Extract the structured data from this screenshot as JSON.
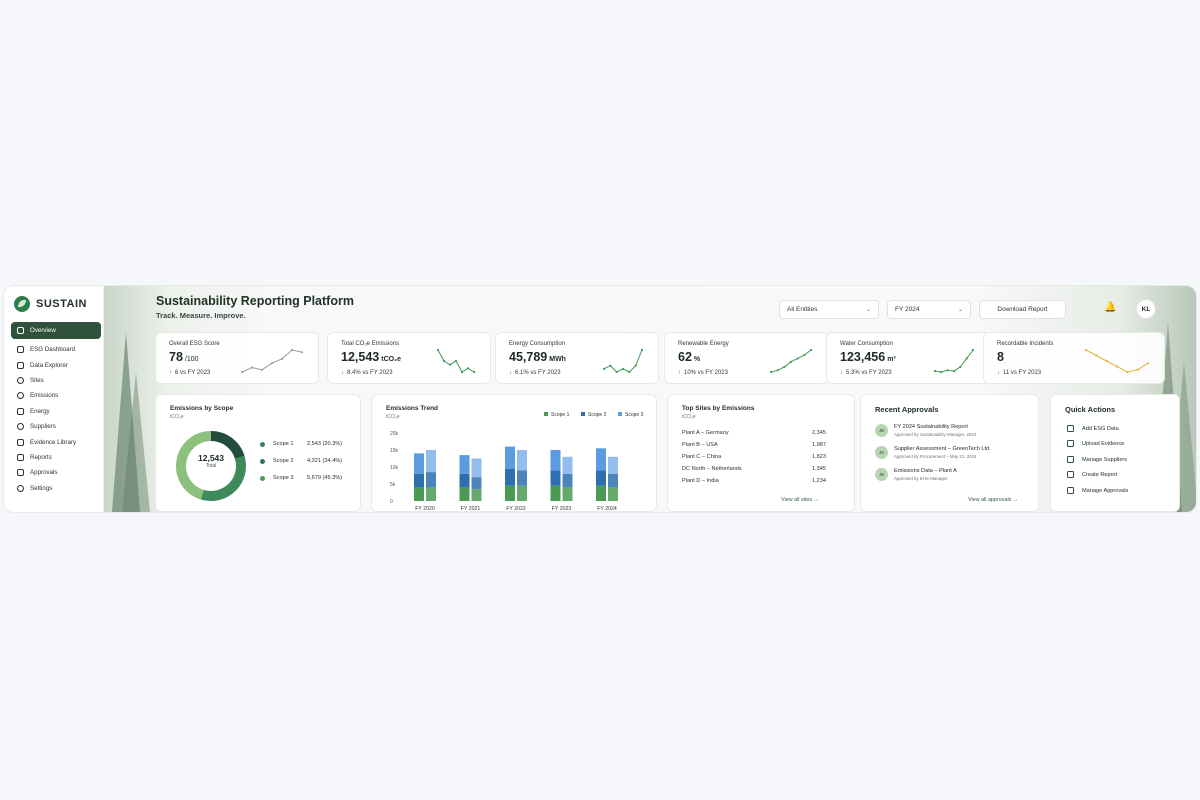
{
  "brand": {
    "name": "SUSTAIN"
  },
  "sidebar": {
    "items": [
      {
        "label": "Overview",
        "icon": "home-icon",
        "active": true
      },
      {
        "label": "ESG Dashboard",
        "icon": "dashboard-icon"
      },
      {
        "label": "Data Explorer",
        "icon": "table-icon"
      },
      {
        "label": "Sites",
        "icon": "pin-icon"
      },
      {
        "label": "Emissions",
        "icon": "cloud-icon"
      },
      {
        "label": "Energy",
        "icon": "bolt-icon"
      },
      {
        "label": "Suppliers",
        "icon": "users-icon"
      },
      {
        "label": "Evidence Library",
        "icon": "folder-icon"
      },
      {
        "label": "Reports",
        "icon": "report-icon"
      },
      {
        "label": "Approvals",
        "icon": "check-icon"
      },
      {
        "label": "Settings",
        "icon": "gear-icon"
      }
    ]
  },
  "header": {
    "title": "Sustainability Reporting Platform",
    "subtitle": "Track. Measure. Improve.",
    "entity_select": "All Entities",
    "year_select": "FY 2024",
    "download_label": "Download Report",
    "avatar_initials": "KL"
  },
  "kpis": [
    {
      "label": "Overall ESG Score",
      "value": "78",
      "unit": "/100",
      "delta": "6",
      "delta_suffix": "vs FY 2023",
      "color": "#9a9a9a",
      "spark": [
        3,
        4,
        3.5,
        5,
        6,
        8,
        7.5
      ]
    },
    {
      "label": "Total CO₂e Emissions",
      "value": "12,543",
      "unit": "tCO₂e",
      "delta": "8.4%",
      "delta_suffix": "vs FY 2023",
      "color": "#3f9a55",
      "spark": [
        9,
        6,
        5,
        6,
        3,
        4,
        3
      ]
    },
    {
      "label": "Energy Consumption",
      "value": "45,789",
      "unit": "MWh",
      "delta": "6.1%",
      "delta_suffix": "vs FY 2023",
      "color": "#3f9a55",
      "spark": [
        5,
        5.5,
        4.5,
        5,
        4.5,
        5.5,
        8
      ]
    },
    {
      "label": "Renewable Energy",
      "value": "62",
      "unit": "%",
      "delta": "10%",
      "delta_suffix": "vs FY 2023",
      "color": "#3f9a55",
      "spark": [
        2,
        2.5,
        3.5,
        5,
        6,
        7,
        8.5
      ]
    },
    {
      "label": "Water Consumption",
      "value": "123,456",
      "unit": "m³",
      "delta": "5.3%",
      "delta_suffix": "vs FY 2023",
      "color": "#3f9a55",
      "spark": [
        3,
        2.8,
        3.2,
        3,
        4,
        6,
        8
      ]
    },
    {
      "label": "Recordable Incidents",
      "value": "8",
      "unit": "",
      "delta": "11",
      "delta_suffix": "vs FY 2023",
      "color": "#e3b33c",
      "spark": [
        6,
        5.5,
        5,
        4.5,
        4,
        4.2,
        4.8
      ]
    }
  ],
  "emissions_by_scope": {
    "title": "Emissions by Scope",
    "unit": "tCO₂e",
    "total": "12,543",
    "total_label": "Total",
    "scopes": [
      {
        "name": "Scope 1",
        "value": "2,543 (20.3%)",
        "color": "#3e7d6b"
      },
      {
        "name": "Scope 2",
        "value": "4,321 (34.4%)",
        "color": "#2f6f6a"
      },
      {
        "name": "Scope 3",
        "value": "5,679 (45.3%)",
        "color": "#4a9a52"
      }
    ]
  },
  "chart_data": {
    "type": "bar",
    "title": "Emissions Trend",
    "ylabel": "tCO₂e",
    "categories": [
      "FY 2020",
      "FY 2021",
      "FY 2022",
      "FY 2023",
      "FY 2024"
    ],
    "yticks": [
      "20k",
      "15k",
      "10k",
      "5k",
      "0"
    ],
    "ylim": [
      0,
      20000
    ],
    "series": [
      {
        "name": "Scope 1",
        "color": "#4a9a52"
      },
      {
        "name": "Scope 2",
        "color": "#2e6fb0"
      },
      {
        "name": "Scope 3",
        "color": "#5b9be0"
      }
    ],
    "bars": [
      [
        [
          4000,
          4000,
          6000
        ],
        [
          4000,
          4500,
          6500
        ]
      ],
      [
        [
          4000,
          4000,
          5500
        ],
        [
          3500,
          3500,
          5500
        ]
      ],
      [
        [
          4500,
          5000,
          6500
        ],
        [
          4500,
          4500,
          6000
        ]
      ],
      [
        [
          4500,
          4500,
          6000
        ],
        [
          4000,
          4000,
          5000
        ]
      ],
      [
        [
          4500,
          4500,
          6500
        ],
        [
          4000,
          4000,
          5000
        ]
      ]
    ],
    "legend": "top-right"
  },
  "top_sites": {
    "title": "Top Sites by Emissions",
    "unit": "tCO₂e",
    "rows": [
      {
        "name": "Plant A – Germany",
        "value": "2,345"
      },
      {
        "name": "Plant B – USA",
        "value": "1,987"
      },
      {
        "name": "Plant C – China",
        "value": "1,823"
      },
      {
        "name": "DC North – Netherlands",
        "value": "1,345"
      },
      {
        "name": "Plant D – India",
        "value": "1,234"
      }
    ],
    "link": "View all sites →"
  },
  "approvals": {
    "title": "Recent Approvals",
    "items": [
      {
        "initials": "JB",
        "title": "FY 2024 Sustainability Report",
        "sub": "Approved by Sustainability Manager, 2024"
      },
      {
        "initials": "JS",
        "title": "Supplier Assessment – GreenTech Ltd.",
        "sub": "Approved by Procurement – May 21, 2024"
      },
      {
        "initials": "JB",
        "title": "Emissions Data – Plant A",
        "sub": "Approved by EHS Manager"
      }
    ],
    "link": "View all approvals →"
  },
  "quick_actions": {
    "title": "Quick Actions",
    "items": [
      {
        "label": "Add ESG Data",
        "icon": "add-data-icon"
      },
      {
        "label": "Upload Evidence",
        "icon": "upload-icon"
      },
      {
        "label": "Manage Suppliers",
        "icon": "users-icon"
      },
      {
        "label": "Create Report",
        "icon": "report-icon"
      },
      {
        "label": "Manage Approvals",
        "icon": "check-icon"
      }
    ]
  }
}
